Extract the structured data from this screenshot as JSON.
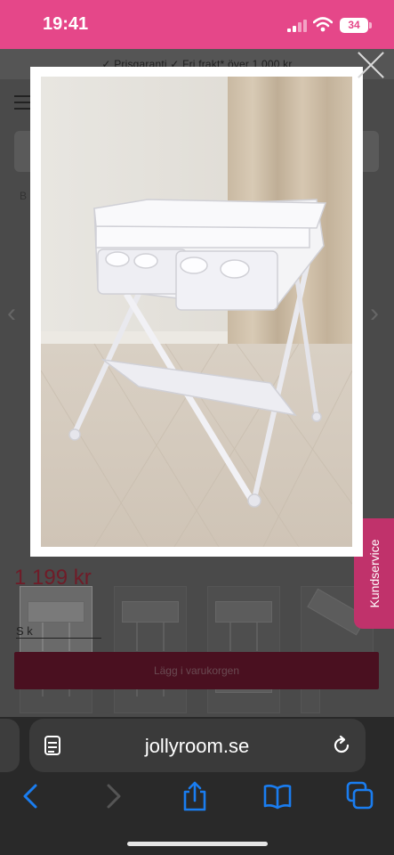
{
  "status_bar": {
    "time": "19:41",
    "battery": "34",
    "colors": {
      "background": "#e54789"
    }
  },
  "page": {
    "usp_text": "✓ Prisgaranti    ✓ Fri frakt* över 1 000 kr",
    "breadcrumb_initial": "B",
    "price": "1 199 kr",
    "link_text": "S                  k",
    "add_to_cart_label": "Lägg i varukorgen",
    "price_color": "#6f1c28"
  },
  "modal": {
    "image_alt": "White baby changing table with folding legs, two storage trays and a mesh lower shelf"
  },
  "customer_service": {
    "label": "Kundservice",
    "color": "#c0326b"
  },
  "browser": {
    "url": "jollyroom.se",
    "icons": [
      "page-format-icon",
      "reload-icon",
      "back-icon",
      "forward-icon",
      "share-icon",
      "bookmarks-icon",
      "tabs-icon"
    ]
  }
}
